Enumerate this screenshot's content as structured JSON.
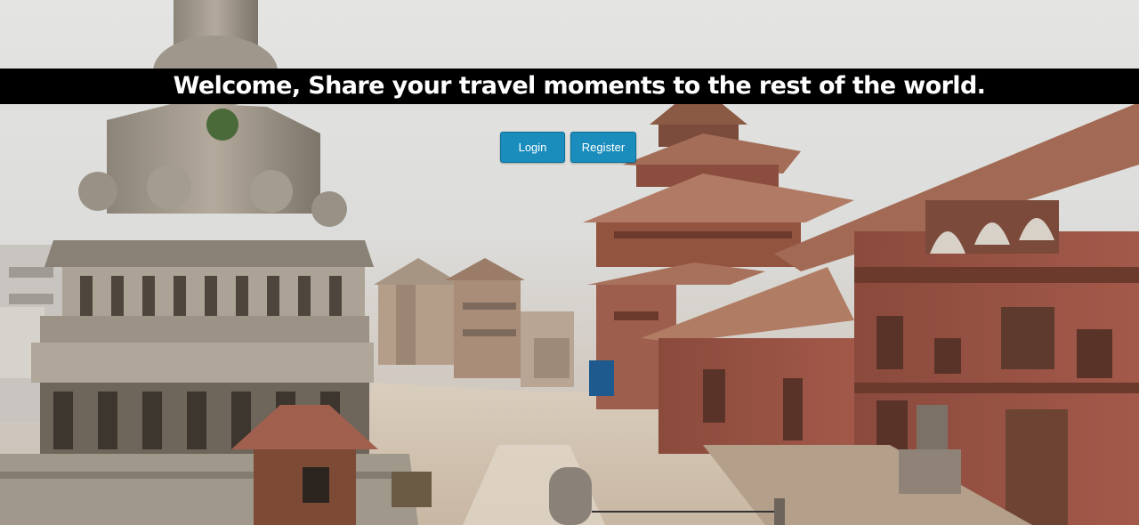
{
  "hero": {
    "headline": "Welcome, Share your travel moments to the rest of the world."
  },
  "actions": {
    "login_label": "Login",
    "register_label": "Register"
  },
  "colors": {
    "banner_background": "#000000",
    "button_background": "#1a8dbd",
    "button_text": "#ffffff"
  }
}
